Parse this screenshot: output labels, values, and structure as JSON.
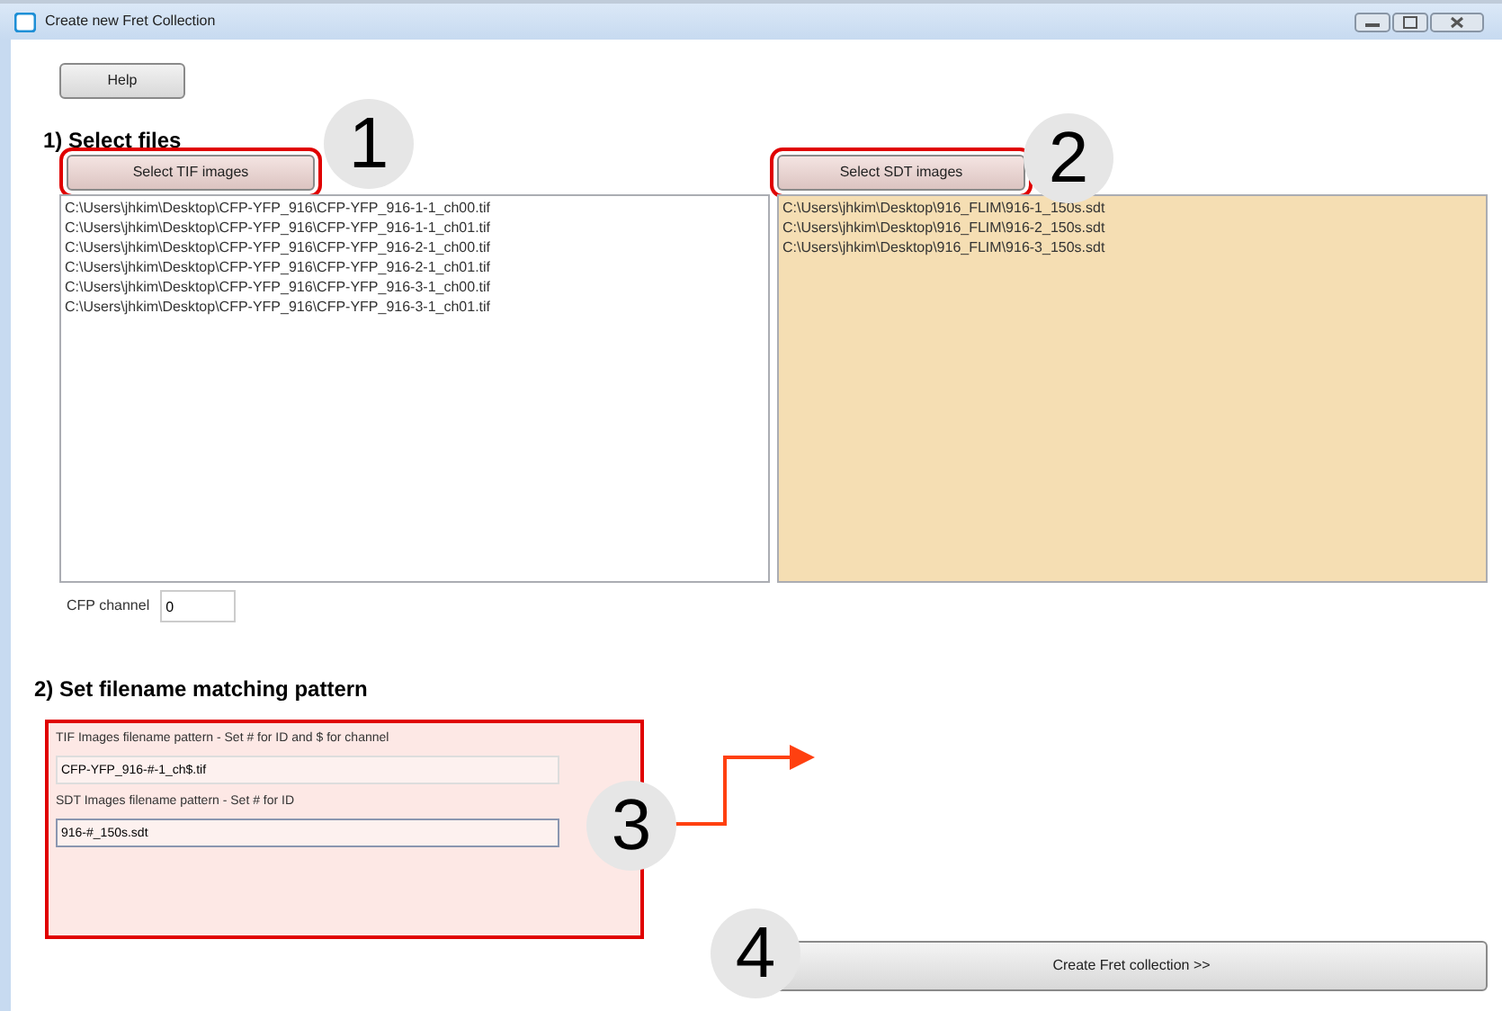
{
  "window": {
    "title": "Create new Fret Collection"
  },
  "help_button": "Help",
  "section_1": {
    "heading": "1) Select files",
    "tif": {
      "button": "Select TIF images",
      "highlighted": true,
      "files": [
        "C:\\Users\\jhkim\\Desktop\\CFP-YFP_916\\CFP-YFP_916-1-1_ch00.tif",
        "C:\\Users\\jhkim\\Desktop\\CFP-YFP_916\\CFP-YFP_916-1-1_ch01.tif",
        "C:\\Users\\jhkim\\Desktop\\CFP-YFP_916\\CFP-YFP_916-2-1_ch00.tif",
        "C:\\Users\\jhkim\\Desktop\\CFP-YFP_916\\CFP-YFP_916-2-1_ch01.tif",
        "C:\\Users\\jhkim\\Desktop\\CFP-YFP_916\\CFP-YFP_916-3-1_ch00.tif",
        "C:\\Users\\jhkim\\Desktop\\CFP-YFP_916\\CFP-YFP_916-3-1_ch01.tif"
      ]
    },
    "sdt": {
      "button": "Select SDT images",
      "highlighted": true,
      "files": [
        "C:\\Users\\jhkim\\Desktop\\916_FLIM\\916-1_150s.sdt",
        "C:\\Users\\jhkim\\Desktop\\916_FLIM\\916-2_150s.sdt",
        "C:\\Users\\jhkim\\Desktop\\916_FLIM\\916-3_150s.sdt"
      ]
    },
    "cfp_channel": {
      "label": "CFP channel",
      "value": "0"
    }
  },
  "section_2": {
    "heading": "2) Set filename matching pattern",
    "highlighted": true,
    "tif_pattern": {
      "label": "TIF Images filename pattern - Set # for ID and $ for channel",
      "value": "CFP-YFP_916-#-1_ch$.tif"
    },
    "sdt_pattern": {
      "label": "SDT Images filename pattern - Set # for ID",
      "value": "916-#_150s.sdt"
    }
  },
  "create_button": "Create Fret collection >>",
  "callouts": [
    "1",
    "2",
    "3",
    "4"
  ]
}
